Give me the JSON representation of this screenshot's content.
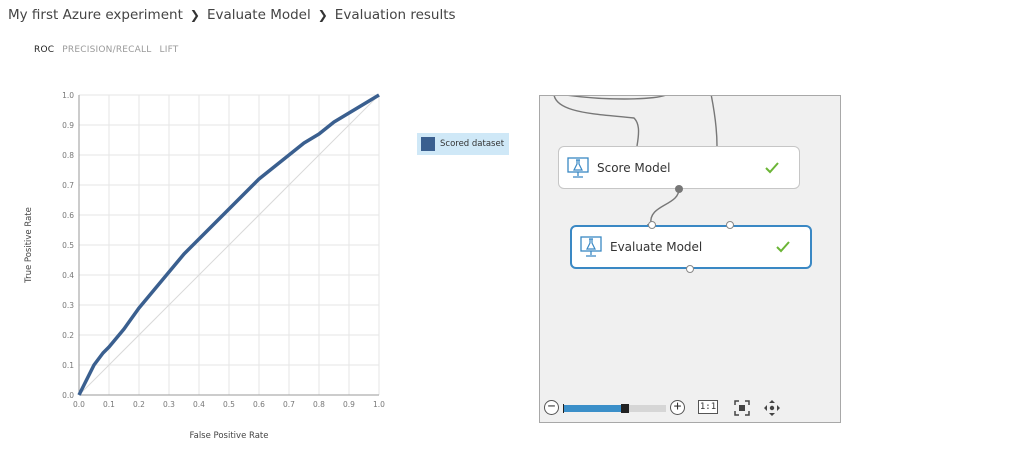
{
  "breadcrumb": {
    "items": [
      "My first Azure experiment",
      "Evaluate Model",
      "Evaluation results"
    ],
    "separator": "❯"
  },
  "tabs": [
    {
      "label": "ROC",
      "active": true
    },
    {
      "label": "PRECISION/RECALL",
      "active": false
    },
    {
      "label": "LIFT",
      "active": false
    }
  ],
  "chart_data": {
    "type": "line",
    "xlabel": "False Positive Rate",
    "ylabel": "True Positive Rate",
    "xlim": [
      0,
      1
    ],
    "ylim": [
      0,
      1
    ],
    "xticks": [
      "0.0",
      "0.1",
      "0.2",
      "0.3",
      "0.4",
      "0.5",
      "0.6",
      "0.7",
      "0.8",
      "0.9",
      "1.0"
    ],
    "yticks": [
      "0.0",
      "0.1",
      "0.2",
      "0.3",
      "0.4",
      "0.5",
      "0.6",
      "0.7",
      "0.8",
      "0.9",
      "1.0"
    ],
    "grid": true,
    "legend_placement": "right",
    "series": [
      {
        "name": "Scored dataset",
        "color": "#3a5f8f",
        "x": [
          0.0,
          0.02,
          0.05,
          0.08,
          0.1,
          0.15,
          0.2,
          0.25,
          0.3,
          0.35,
          0.4,
          0.45,
          0.5,
          0.55,
          0.6,
          0.65,
          0.7,
          0.75,
          0.8,
          0.85,
          0.9,
          0.95,
          1.0
        ],
        "y": [
          0.0,
          0.04,
          0.1,
          0.14,
          0.16,
          0.22,
          0.29,
          0.35,
          0.41,
          0.47,
          0.52,
          0.57,
          0.62,
          0.67,
          0.72,
          0.76,
          0.8,
          0.84,
          0.87,
          0.91,
          0.94,
          0.97,
          1.0
        ]
      }
    ],
    "diagonal_color": "#d9d9d9"
  },
  "canvas": {
    "modules": [
      {
        "id": "score",
        "label": "Score Model",
        "status": "completed",
        "selected": false
      },
      {
        "id": "evaluate",
        "label": "Evaluate Model",
        "status": "completed",
        "selected": true
      }
    ],
    "zoom": {
      "minus_symbol": "−",
      "plus_symbol": "+",
      "one_to_one_label": "1:1",
      "level": 0.6
    },
    "colors": {
      "check": "#6bb536",
      "selected_border": "#3a88c4",
      "zoom_fill": "#3b8fc9"
    }
  }
}
